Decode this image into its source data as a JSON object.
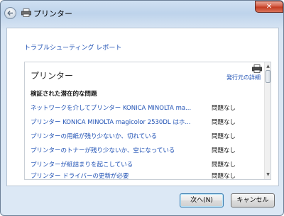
{
  "window": {
    "title": "プリンター"
  },
  "header": {
    "link_text": "トラブルシューティング レポート"
  },
  "report": {
    "title": "プリンター",
    "publisher_link": "発行元の詳細",
    "section_heading": "検証された潜在的な問題",
    "rows": [
      {
        "issue": "ネットワークを介してプリンター KONICA MINOLTA ma...",
        "status": "問題なし"
      },
      {
        "issue": "プリンター KONICA MINOLTA magicolor 2530DL はホ...",
        "status": "問題なし"
      },
      {
        "issue": "プリンターの用紙が残り少ないか、切れている",
        "status": "問題なし"
      },
      {
        "issue": "プリンターのトナーが残り少ないか、空になっている",
        "status": "問題なし"
      },
      {
        "issue": "プリンターが紙詰まりを起こしている",
        "status": "問題なし"
      },
      {
        "issue": "プリンター ドライバーの更新が必要",
        "status": "問題なし"
      }
    ]
  },
  "footer": {
    "next_label": "次へ(N)",
    "cancel_label": "キャンセル"
  },
  "icons": {
    "back": "back-arrow-icon",
    "title": "printer-icon",
    "report_print": "printer-icon",
    "close": "close-icon"
  },
  "colors": {
    "link": "#1e50b4",
    "titlebar": "#bed3eb",
    "close": "#c23a1f"
  }
}
